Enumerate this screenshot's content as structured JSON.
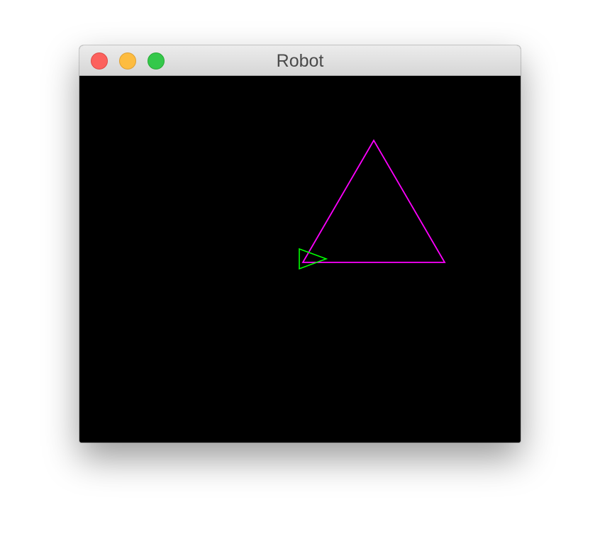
{
  "window": {
    "title": "Robot",
    "buttons": {
      "close": "close",
      "minimize": "minimize",
      "zoom": "zoom"
    }
  },
  "canvas": {
    "background": "#000000",
    "shapes": [
      {
        "name": "path-triangle",
        "color": "#ff00ff"
      },
      {
        "name": "robot-marker",
        "color": "#00ff00"
      }
    ]
  }
}
